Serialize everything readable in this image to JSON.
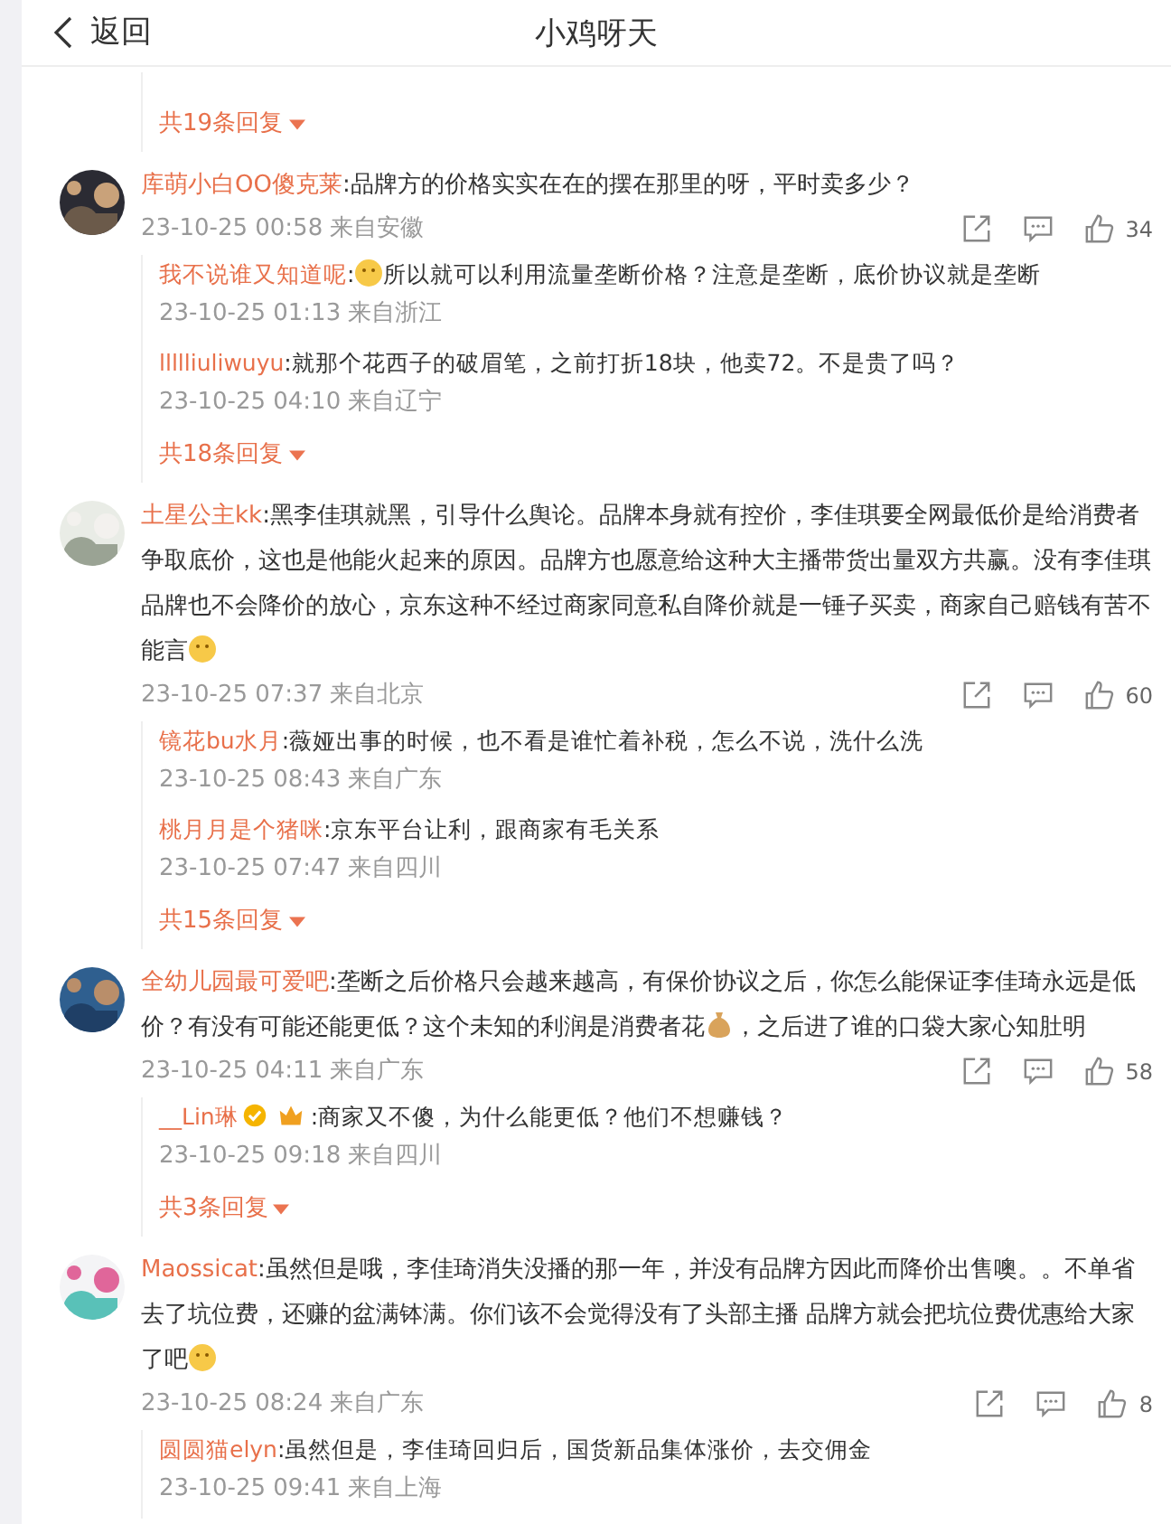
{
  "header": {
    "back": "返回",
    "title": "小鸡呀天"
  },
  "leading_thread": {
    "more": "共19条回复"
  },
  "comments": [
    {
      "author": "库萌小白OO傻克莱",
      "segments": [
        {
          "kind": "text",
          "text": ":品牌方的价格实实在在的摆在那里的呀，平时卖多少？"
        }
      ],
      "date": "23-10-25 00:58 来自安徽",
      "likes": "34",
      "replies": [
        {
          "author": "我不说谁又知道呢",
          "segments": [
            {
              "kind": "text",
              "text": ":"
            },
            {
              "kind": "emoji"
            },
            {
              "kind": "text",
              "text": "所以就可以利用流量垄断价格？注意是垄断，底价协议就是垄断"
            }
          ],
          "date": "23-10-25 01:13 来自浙江"
        },
        {
          "author": "llllliuliwuyu",
          "segments": [
            {
              "kind": "text",
              "text": ":就那个花西子的破眉笔，之前打折18块，他卖72。不是贵了吗？"
            }
          ],
          "date": "23-10-25 04:10 来自辽宁"
        }
      ],
      "more": "共18条回复"
    },
    {
      "author": "土星公主kk",
      "segments": [
        {
          "kind": "text",
          "text": ":黑李佳琪就黑，引导什么舆论。品牌本身就有控价，李佳琪要全网最低价是给消费者争取底价，这也是他能火起来的原因。品牌方也愿意给这种大主播带货出量双方共赢。没有李佳琪品牌也不会降价的放心，京东这种不经过商家同意私自降价就是一锤子买卖，商家自己赔钱有苦不能言"
        },
        {
          "kind": "emoji"
        }
      ],
      "date": "23-10-25 07:37 来自北京",
      "likes": "60",
      "replies": [
        {
          "author": "镜花bu水月",
          "segments": [
            {
              "kind": "text",
              "text": ":薇娅出事的时候，也不看是谁忙着补税，怎么不说，洗什么洗"
            }
          ],
          "date": "23-10-25 08:43 来自广东"
        },
        {
          "author": "桃月月是个猪咪",
          "segments": [
            {
              "kind": "text",
              "text": ":京东平台让利，跟商家有毛关系"
            }
          ],
          "date": "23-10-25 07:47 来自四川"
        }
      ],
      "more": "共15条回复"
    },
    {
      "author": "全幼儿园最可爱吧",
      "segments": [
        {
          "kind": "text",
          "text": ":垄断之后价格只会越来越高，有保价协议之后，你怎么能保证李佳琦永远是低价？有没有可能还能更低？这个未知的利润是消费者花"
        },
        {
          "kind": "money-bag"
        },
        {
          "kind": "text",
          "text": "，之后进了谁的口袋大家心知肚明"
        }
      ],
      "date": "23-10-25 04:11 来自广东",
      "likes": "58",
      "replies": [
        {
          "author": "__Lin琳",
          "badges": [
            {
              "kind": "verified"
            },
            {
              "kind": "crown"
            }
          ],
          "segments": [
            {
              "kind": "text",
              "text": ":商家又不傻，为什么能更低？他们不想赚钱？"
            }
          ],
          "date": "23-10-25 09:18 来自四川"
        }
      ],
      "more": "共3条回复"
    },
    {
      "author": "Maossicat",
      "segments": [
        {
          "kind": "text",
          "text": ":虽然但是哦，李佳琦消失没播的那一年，并没有品牌方因此而降价出售噢。。不单省去了坑位费，还赚的盆满钵满。你们该不会觉得没有了头部主播 品牌方就会把坑位费优惠给大家了吧"
        },
        {
          "kind": "emoji"
        }
      ],
      "date": "23-10-25 08:24 来自广东",
      "likes": "8",
      "replies": [
        {
          "author": "圆圆猫elyn",
          "segments": [
            {
              "kind": "text",
              "text": ":虽然但是，李佳琦回归后，国货新品集体涨价，去交佣金"
            }
          ],
          "date": "23-10-25 09:41 来自上海"
        }
      ]
    }
  ]
}
